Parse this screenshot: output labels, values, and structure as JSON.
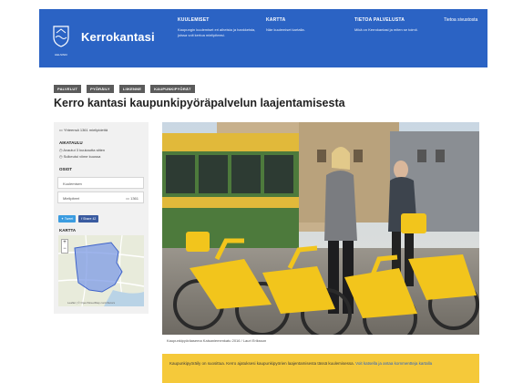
{
  "header": {
    "brand": "Kerrokantasi",
    "logo_label": "HELSINKI",
    "columns": [
      {
        "title": "KUULEMISET",
        "desc": "Kaupungin kuulemiset eri aiheista ja hankkeista, joissa voit kertoa mielipiteesi."
      },
      {
        "title": "KARTTA",
        "desc": "Näe kuulemiset kartalla."
      },
      {
        "title": "TIETOA PALVELUSTA",
        "desc": "Mikä on Kerrokantasi ja miten se toimii."
      }
    ],
    "link": "Tietoa sivustosta"
  },
  "tags": [
    "PALVELUT",
    "PYÖRÄILY",
    "LIIKENNE",
    "KAUPUNKIPYÖRÄT"
  ],
  "title": "Kerro kantasi kaupunkipyöräpalvelun laajentamisesta",
  "sidebar": {
    "opinions": "Yhteensä 1361 mielipidettä",
    "schedule_head": "AIKATAULU",
    "schedule_open": "Avautui 3 kuukautta sitten",
    "schedule_closed": "Sulkeutui viime kuussa",
    "sections_head": "OSIOT",
    "section_1": "Kuulemisen",
    "section_2": "Mielipiteet",
    "section_2_count": "1361",
    "share_tweet": "Tweet",
    "share_fb": "Share 42",
    "map_head": "KARTTA",
    "map_attrib": "Leaflet | © OpenStreetMap contributors"
  },
  "photo_caption": "Kaupunkipyöräasema Kaisaniemenkatu 2016 / Lauri Eriksson",
  "notice": {
    "text": "Kaupunkipyöräily on suosittua. Kerro ajatuksesi kaupunkipyörien laajentamisesta tässä kuulemisessa.",
    "link": "Voit katsella ja antaa kommentteja kartalla"
  },
  "colors": {
    "header": "#2b63c4",
    "notice": "#f5c93a",
    "bike": "#f2c51c"
  }
}
